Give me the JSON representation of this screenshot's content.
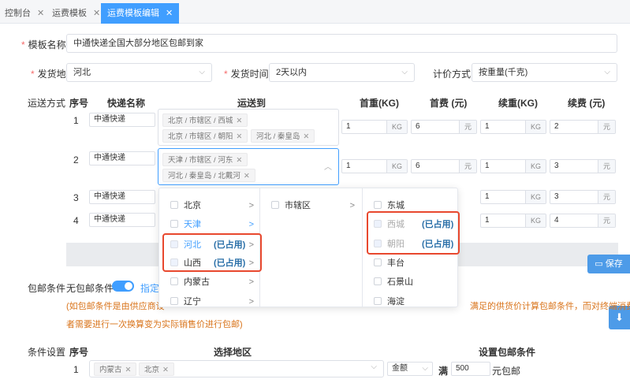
{
  "tabs": [
    {
      "label": "控制台"
    },
    {
      "label": "运费模板"
    },
    {
      "label": "运费模板编辑"
    }
  ],
  "form": {
    "template_name_label": "模板名称",
    "template_name_value": "中通快递全国大部分地区包邮到家",
    "ship_from_label": "发货地",
    "ship_from_value": "河北",
    "ship_time_label": "发货时间",
    "ship_time_value": "2天以内",
    "pricing_label": "计价方式",
    "pricing_value": "按重量(千克)",
    "shipping_method_label": "运送方式"
  },
  "shipping_table": {
    "headers": {
      "no": "序号",
      "courier": "快递名称",
      "to": "运送到",
      "first_weight": "首重(KG)",
      "first_fee": "首费 (元)",
      "extra_weight": "续重(KG)",
      "extra_fee": "续费 (元)"
    },
    "units": {
      "kg": "KG",
      "yuan": "元"
    },
    "rows": [
      {
        "no": "1",
        "courier": "中通快递",
        "tags": [
          "北京 / 市辖区 / 西城",
          "北京 / 市辖区 / 朝阳",
          "河北 / 秦皇岛"
        ],
        "first_weight": "1",
        "first_fee": "6",
        "extra_weight": "1",
        "extra_fee": "2"
      },
      {
        "no": "2",
        "courier": "中通快递",
        "tags": [
          "天津 / 市辖区 / 河东",
          "河北 / 秦皇岛 / 北戴河"
        ],
        "first_weight": "1",
        "first_fee": "6",
        "extra_weight": "1",
        "extra_fee": "3"
      },
      {
        "no": "3",
        "courier": "中通快递",
        "tags": [],
        "first_weight": "",
        "first_fee": "",
        "extra_weight": "1",
        "extra_fee": "3"
      },
      {
        "no": "4",
        "courier": "中通快递",
        "tags": [],
        "first_weight": "",
        "first_fee": "",
        "extra_weight": "1",
        "extra_fee": "4"
      }
    ]
  },
  "cascader": {
    "provinces": [
      {
        "label": "北京",
        "occupied": ""
      },
      {
        "label": "天津",
        "occupied": ""
      },
      {
        "label": "河北",
        "occupied": "(已占用)"
      },
      {
        "label": "山西",
        "occupied": "(已占用)"
      },
      {
        "label": "内蒙古",
        "occupied": ""
      },
      {
        "label": "辽宁",
        "occupied": ""
      }
    ],
    "cities": [
      {
        "label": "市辖区"
      }
    ],
    "districts": [
      {
        "label": "东城",
        "occupied": ""
      },
      {
        "label": "西城",
        "occupied": "(已占用)"
      },
      {
        "label": "朝阳",
        "occupied": "(已占用)"
      },
      {
        "label": "丰台",
        "occupied": ""
      },
      {
        "label": "石景山",
        "occupied": ""
      },
      {
        "label": "海淀",
        "occupied": ""
      }
    ]
  },
  "free_shipping": {
    "label": "包邮条件",
    "no_condition": "无包邮条件",
    "specified": "指定",
    "notice_left": "(如包邮条件是由供应商设",
    "notice_right": "满足的供货价计算包邮条件，而对终端消费",
    "notice_line2": "者需要进行一次换算变为实际销售价进行包邮)"
  },
  "conditions": {
    "label": "条件设置",
    "headers": {
      "no": "序号",
      "region": "选择地区",
      "condition": "设置包邮条件"
    },
    "row": {
      "no": "1",
      "tags": [
        "内蒙古",
        "北京"
      ],
      "type": "金额",
      "full": "满",
      "amount": "500",
      "suffix": "元包邮"
    }
  },
  "actions": {
    "save": "保存"
  },
  "colors": {
    "primary": "#409eff",
    "highlight": "#e8482e",
    "notice": "#d9741b"
  }
}
